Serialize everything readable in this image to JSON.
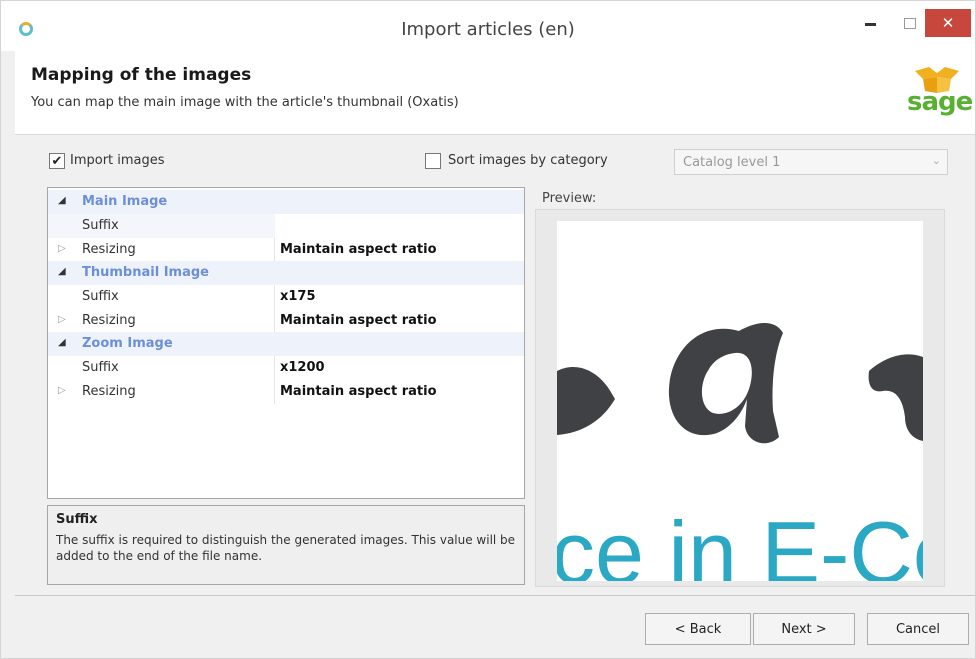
{
  "window": {
    "title": "Import articles (en)",
    "close_glyph": "✕"
  },
  "header": {
    "title": "Mapping of the images",
    "subtitle": "You can map the main image with the article's thumbnail (Oxatis)",
    "logo_text": "sage",
    "logo_colors": {
      "text": "#57b030",
      "box": "#f0b020"
    }
  },
  "options": {
    "import_images": {
      "label": "Import images",
      "checked": true,
      "check_glyph": "✔"
    },
    "sort_by_category": {
      "label": "Sort images by category",
      "checked": false
    },
    "catalog_select": {
      "value": "Catalog level 1",
      "arrow_glyph": "⌄"
    }
  },
  "grid": {
    "expanded_glyph": "◢",
    "collapsed_glyph": "▷",
    "sections": [
      {
        "name": "Main Image",
        "rows": [
          {
            "label": "Suffix",
            "value": "",
            "expandable": false
          },
          {
            "label": "Resizing",
            "value": "Maintain aspect ratio",
            "expandable": true
          }
        ]
      },
      {
        "name": "Thumbnail Image",
        "rows": [
          {
            "label": "Suffix",
            "value": "x175",
            "expandable": false
          },
          {
            "label": "Resizing",
            "value": "Maintain aspect ratio",
            "expandable": true
          }
        ]
      },
      {
        "name": "Zoom Image",
        "rows": [
          {
            "label": "Suffix",
            "value": "x1200",
            "expandable": false
          },
          {
            "label": "Resizing",
            "value": "Maintain aspect ratio",
            "expandable": true
          }
        ]
      }
    ]
  },
  "description": {
    "title": "Suffix",
    "text": "The suffix is required to distinguish the generated images. This value will be added to the end of the file name."
  },
  "preview": {
    "label": "Preview:",
    "image_text_bottom": "ce in E-Co",
    "image_colors": {
      "logo": "#404144",
      "text": "#2aa8c4"
    }
  },
  "buttons": {
    "back": "< Back",
    "next": "Next >",
    "cancel": "Cancel"
  }
}
